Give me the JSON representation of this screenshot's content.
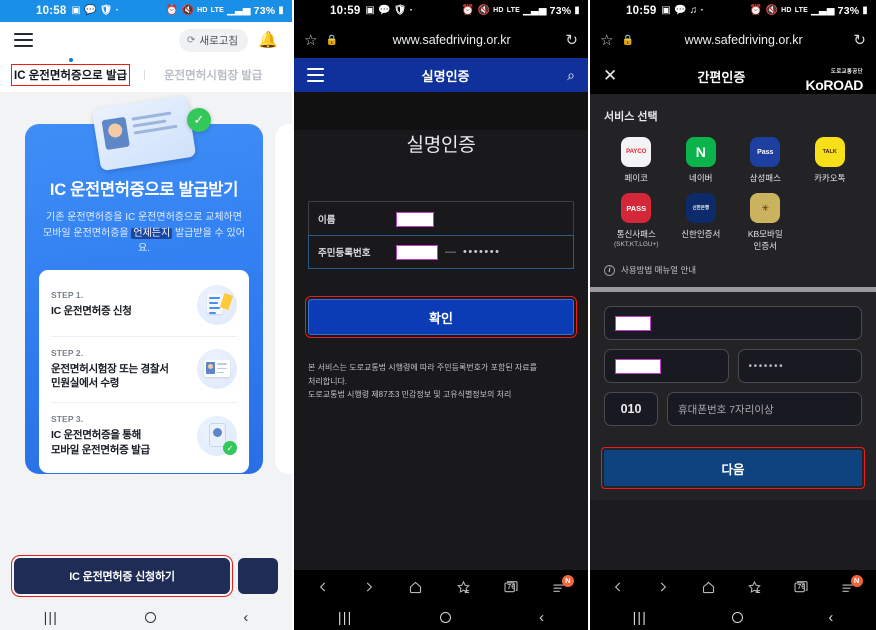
{
  "panel1": {
    "status": {
      "time": "10:58",
      "battery": "73%",
      "net_hd": "HD",
      "net_lte": "LTE"
    },
    "appbar": {
      "refresh_label": "새로고침"
    },
    "tabs": [
      {
        "label": "IC 운전면허증으로 발급",
        "active": true
      },
      {
        "label": "운전면허시험장 발급",
        "active": false
      }
    ],
    "tab_separator": "|",
    "card": {
      "title": "IC 운전면허증으로 발급받기",
      "sub_line1": "기존 운전면허증을 IC 운전면허증으로 교체하면",
      "sub_line2_pre": "모바일 운전면허증을 ",
      "sub_line2_hl": "언제든지",
      "sub_line2_post": " 발급받을 수 있어요.",
      "steps": [
        {
          "no": "STEP 1.",
          "name": "IC 운전면허증 신청"
        },
        {
          "no": "STEP 2.",
          "name": "운전면허시험장 또는 경찰서\n민원실에서 수령"
        },
        {
          "no": "STEP 3.",
          "name": "IC 운전면허증을 통해\n모바일 운전면허증 발급"
        }
      ]
    },
    "cta_label": "IC 운전면허증 신청하기"
  },
  "panel2": {
    "status": {
      "time": "10:59",
      "battery": "73%",
      "net_hd": "HD",
      "net_lte": "LTE"
    },
    "browser": {
      "url": "www.safedriving.or.kr",
      "tab_count": "76",
      "menu_badge": "N"
    },
    "appbar": {
      "title": "실명인증"
    },
    "heading": "실명인증",
    "form": {
      "name_label": "이름",
      "name_value": "",
      "rrn_label": "주민등록번호",
      "rrn_front": "",
      "rrn_dash": "—",
      "rrn_back_masked": "•••••••"
    },
    "confirm_label": "확인",
    "note_line1": "본 서비스는 도로교통법 시행령에 따라 주민등록번호가 포함된 자료를",
    "note_line2": "처리합니다.",
    "note_line3": "도로교통법 시행령 제87조3 민감정보 및 고유식별정보의 처리"
  },
  "panel3": {
    "status": {
      "time": "10:59",
      "battery": "73%",
      "net_hd": "HD",
      "net_lte": "LTE"
    },
    "browser": {
      "url": "www.safedriving.or.kr",
      "tab_count": "76",
      "menu_badge": "N"
    },
    "appbar": {
      "title": "간편인증",
      "logo_top": "도로교통공단",
      "logo_main": "KoROAD"
    },
    "section_title": "서비스 선택",
    "services": [
      {
        "label": "페이코",
        "sub": "",
        "icon_text": "PAYCO",
        "bg": "#f4f4f6",
        "fg": "#e8222d"
      },
      {
        "label": "네이버",
        "sub": "",
        "icon_text": "N",
        "bg": "#0ab34b",
        "fg": "#ffffff"
      },
      {
        "label": "삼성패스",
        "sub": "",
        "icon_text": "Pass",
        "bg": "#1c3fa0",
        "fg": "#ffffff"
      },
      {
        "label": "카카오톡",
        "sub": "",
        "icon_text": "TALK",
        "bg": "#f7e017",
        "fg": "#3c1e1e"
      },
      {
        "label": "통신사패스",
        "sub": "(SKT,KT,LGU+)",
        "icon_text": "PASS",
        "bg": "#d4273a",
        "fg": "#ffffff"
      },
      {
        "label": "신한인증서",
        "sub": "",
        "icon_text": "신한은행",
        "bg": "#0d2a6b",
        "fg": "#ffffff"
      },
      {
        "label": "KB모바일\n인증서",
        "sub": "",
        "icon_text": "KB",
        "bg": "#cbb25e",
        "fg": "#403518"
      }
    ],
    "manual_label": "사용방법 매뉴얼 안내",
    "form": {
      "name_value": "",
      "rrn_front": "",
      "rrn_back_masked": "•••••••",
      "phone_prefix": "010",
      "phone_placeholder": "휴대폰번호 7자리이상"
    },
    "next_label": "다음"
  },
  "colors": {
    "status_blue": "#1a8fe8",
    "brand_navy": "#1f2d56",
    "header_blue": "#10309b",
    "confirm_blue": "#0b3bb5",
    "next_blue": "#0f4380",
    "highlight_red": "#ef1b1b",
    "badge_orange": "#f4643c"
  }
}
